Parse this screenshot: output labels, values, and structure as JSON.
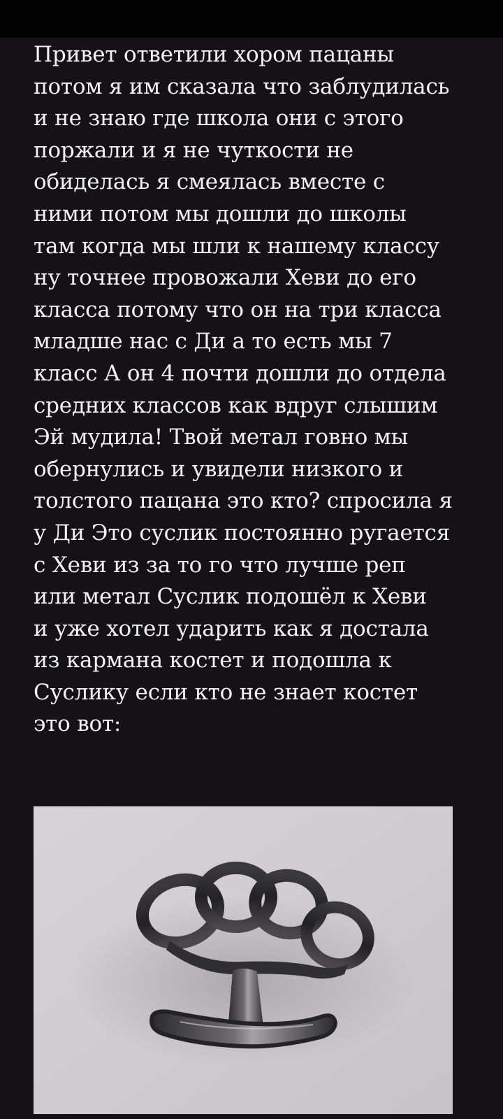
{
  "story": {
    "lines": [
      "Привет ответили хором пацаны",
      "потом я им сказала что заблудилась",
      "и не знаю где школа они с этого",
      "поржали и я не чуткости не",
      "обиделась я смеялась вместе с",
      "ними потом мы дошли до школы",
      "там когда мы шли к нашему классу",
      "ну точнее провожали Хеви до его",
      "класса потому что он на три класса",
      "младше нас с Ди а то есть мы 7",
      "класс А он 4 почти дошли до отдела",
      "средних классов как вдруг слышим",
      "Эй мудила! Твой метал говно мы",
      "обернулись и увидели низкого и",
      "толстого пацана это кто? спросила я",
      "у Ди Это  суслик постоянно ругается",
      "с Хеви из за то го что лучше реп",
      "или метал Суслик подошёл к Хеви",
      "и уже хотел ударить как я достала",
      "из кармана костет и подошла к",
      "Суслику если кто не знает костет",
      "это вот:"
    ]
  },
  "image": {
    "subject": "brass-knuckles-photo",
    "background_color": "#cfcdd0",
    "metal_color": "#2a292c"
  },
  "colors": {
    "page_background": "#141216",
    "top_bar": "#000000",
    "text": "#f3f1f4"
  }
}
